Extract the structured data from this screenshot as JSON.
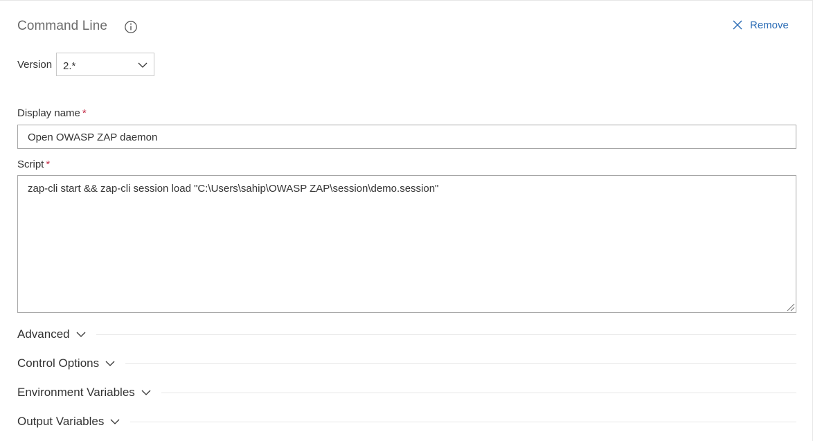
{
  "task": {
    "title": "Command Line",
    "info_icon": "info-circle-icon",
    "remove_label": "Remove",
    "remove_icon": "close-icon"
  },
  "version": {
    "label": "Version",
    "value": "2.*",
    "icon": "chevron-down-icon"
  },
  "display_name": {
    "label": "Display name",
    "required_mark": "*",
    "value": "Open OWASP ZAP daemon"
  },
  "script": {
    "label": "Script",
    "required_mark": "*",
    "value": "zap-cli start && zap-cli session load \"C:\\Users\\sahip\\OWASP ZAP\\session\\demo.session\""
  },
  "sections": [
    {
      "label": "Advanced"
    },
    {
      "label": "Control Options"
    },
    {
      "label": "Environment Variables"
    },
    {
      "label": "Output Variables"
    }
  ],
  "colors": {
    "link": "#2b6cb5",
    "required": "#c4314b",
    "title": "#6b6b6b",
    "text": "#333333",
    "border": "#a6a6a6"
  }
}
